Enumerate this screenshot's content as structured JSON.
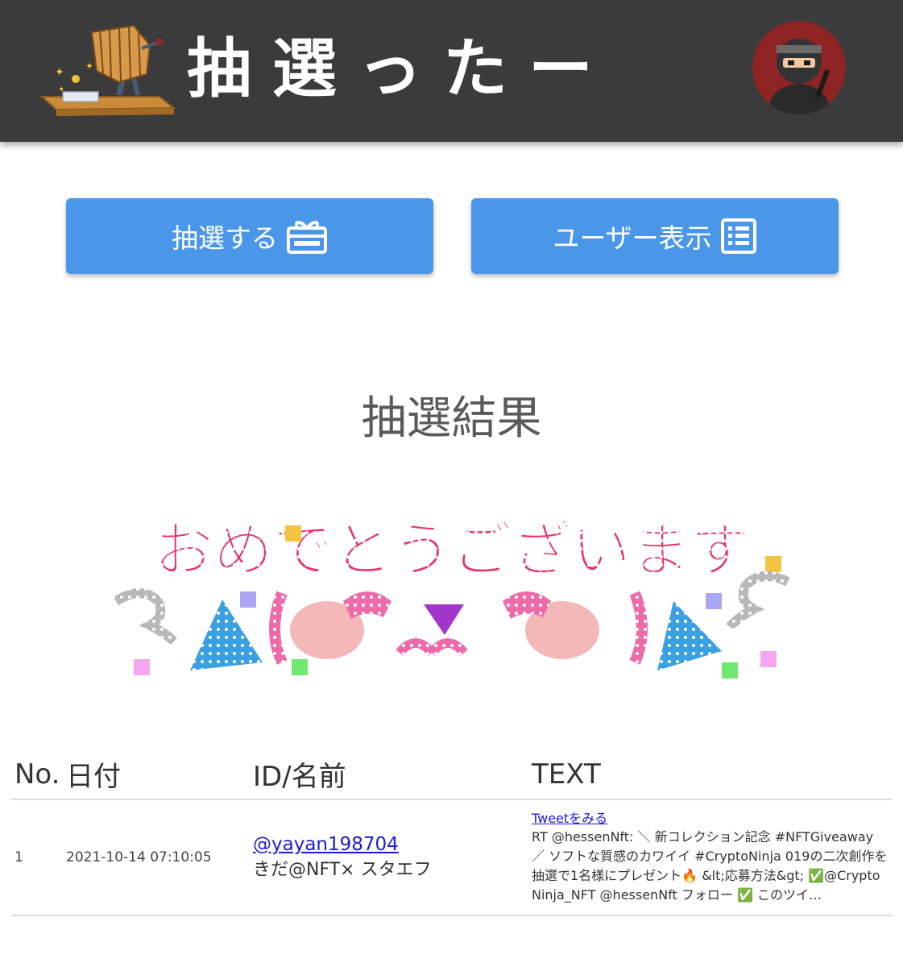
{
  "header": {
    "app_title": "抽選ったー"
  },
  "buttons": {
    "draw_label": "抽選する",
    "users_label": "ユーザー表示"
  },
  "result": {
    "title": "抽選結果",
    "banner_text": "おめでとうございます"
  },
  "table": {
    "headers": {
      "no": "No.",
      "date": "日付",
      "id_name": "ID/名前",
      "text": "TEXT"
    },
    "rows": [
      {
        "no": "1",
        "date": "2021-10-14 07:10:05",
        "user_id": "@yayan198704",
        "user_name": "きだ@NFT× スタエフ",
        "tweet_link": "Tweetをみる",
        "tweet_text": "RT @hessenNft: ＼ 新コレクション記念 #NFTGiveaway ／ ソフトな質感のカワイイ #CryptoNinja 019の二次創作を抽選で1名様にプレゼント🔥 &lt;応募方法&gt; ✅@CryptoNinja_NFT @hessenNft フォロー ✅ このツイ…"
      }
    ]
  },
  "colors": {
    "header_bg": "#3b3b3b",
    "button_bg": "#4a97ea",
    "link": "#1a1adc"
  },
  "icons": {
    "logo": "lottery-drum-icon",
    "draw": "gift-box-icon",
    "users": "list-icon",
    "avatar": "ninja-avatar"
  }
}
